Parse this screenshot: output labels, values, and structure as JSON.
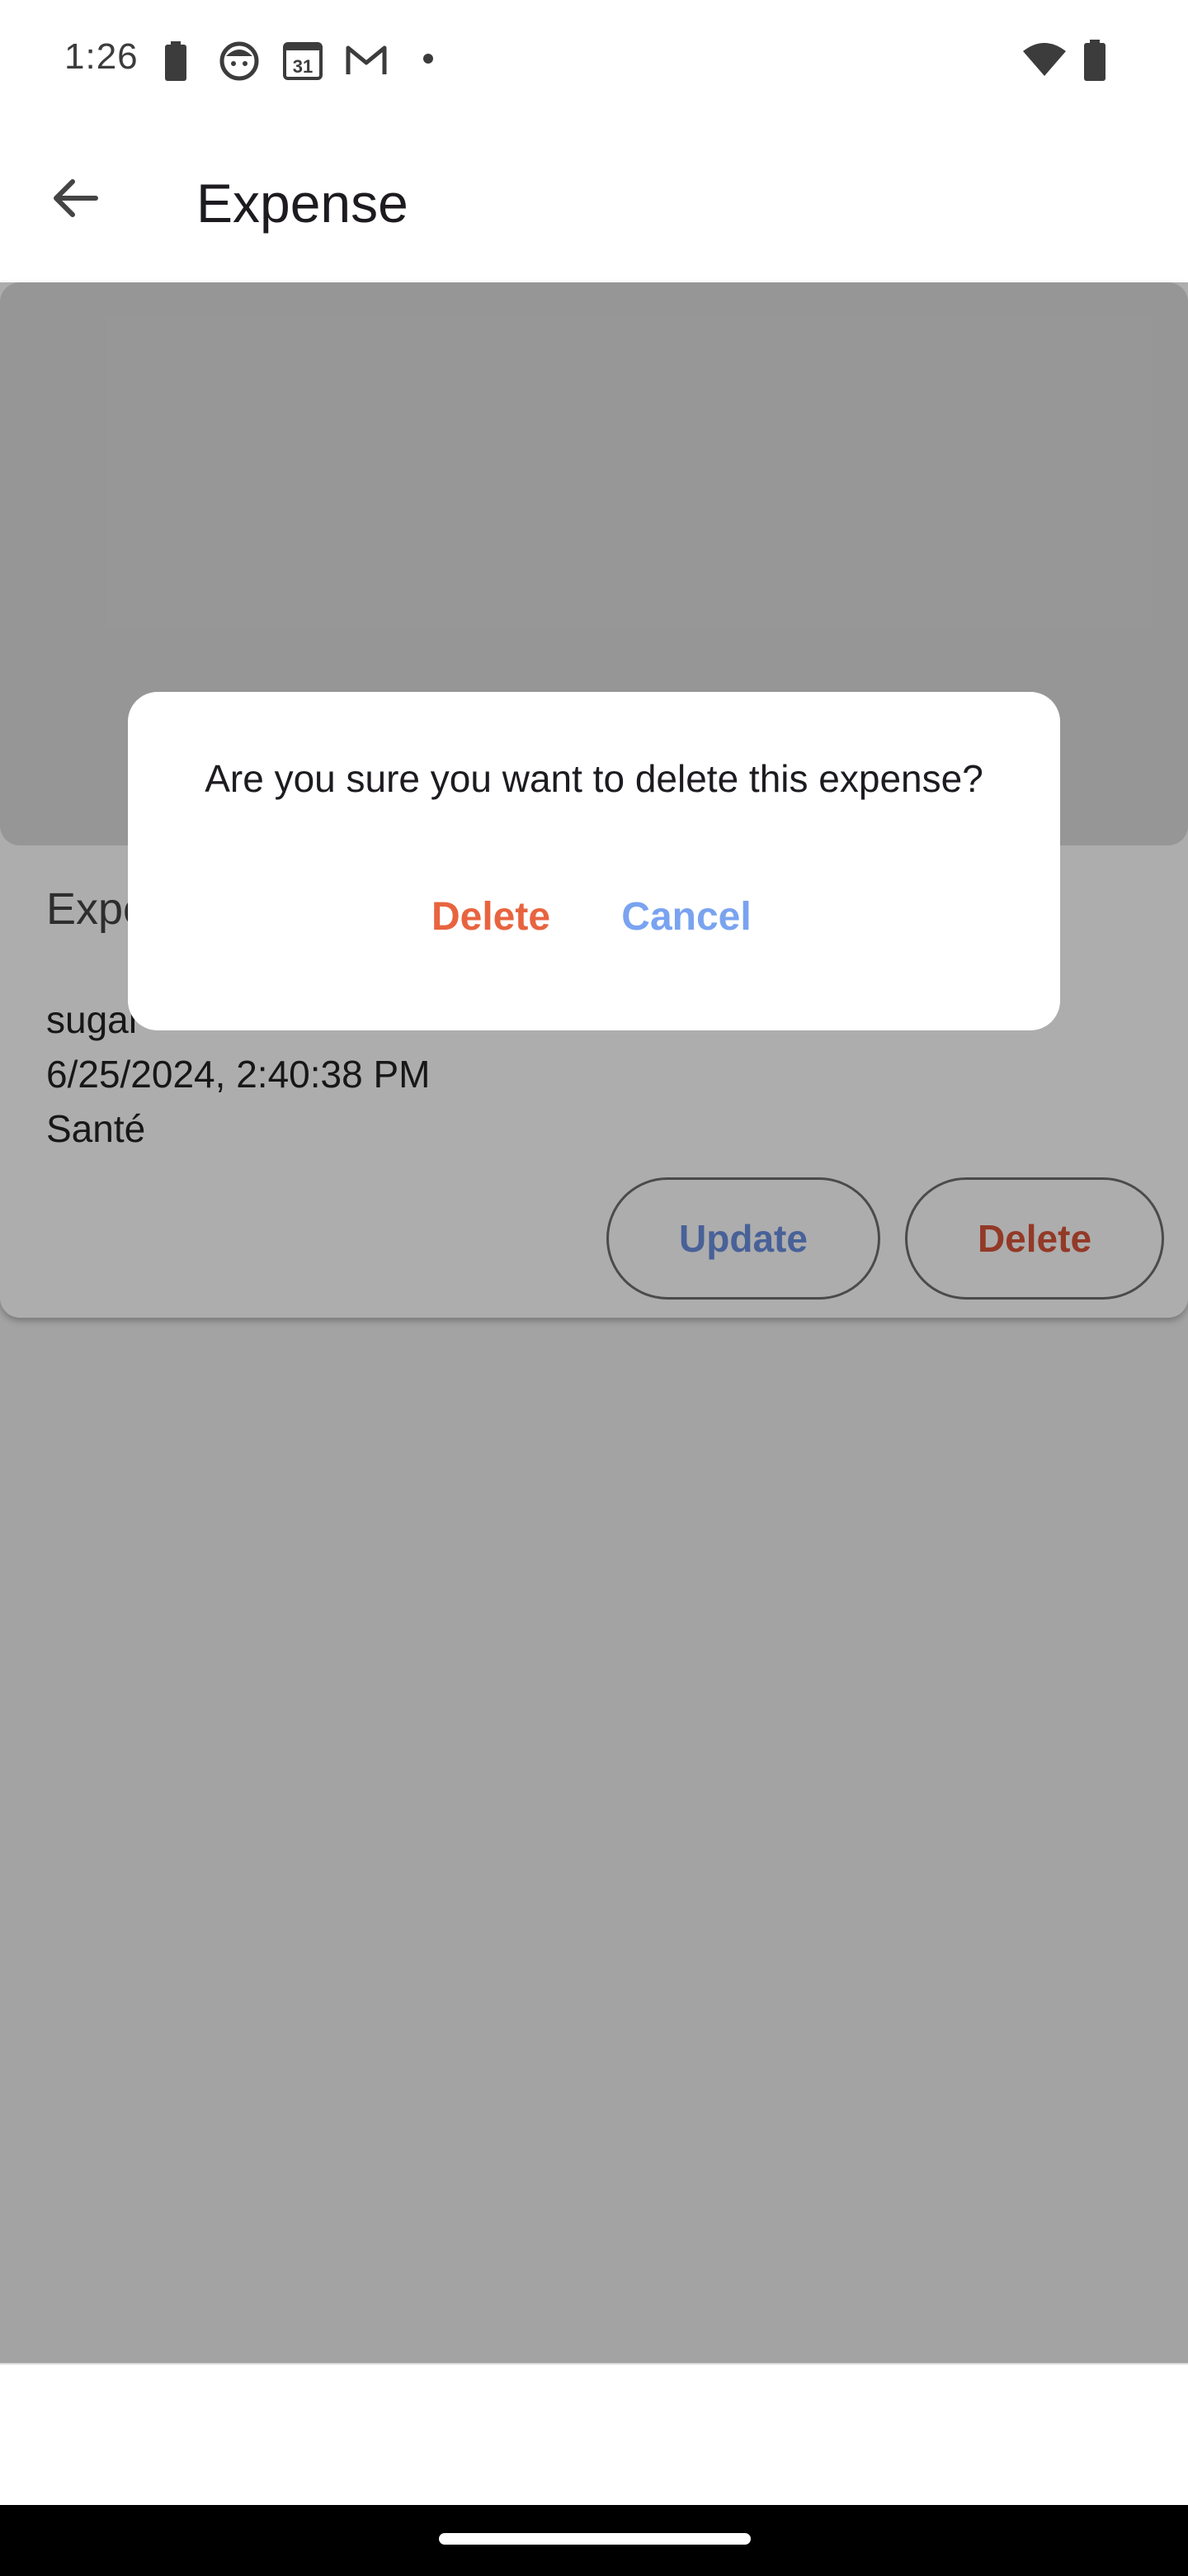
{
  "status_bar": {
    "time": "1:26",
    "icons": [
      "battery-saver-icon",
      "face-icon",
      "calendar-icon",
      "gmail-icon",
      "dot-icon",
      "wifi-icon",
      "battery-icon"
    ],
    "calendar_day": "31"
  },
  "app_bar": {
    "title": "Expense",
    "back_icon": "arrow-back-icon"
  },
  "expense": {
    "section_title": "Expe",
    "name": "sugar",
    "datetime": "6/25/2024, 2:40:38 PM",
    "category": "Santé",
    "update_label": "Update",
    "delete_label": "Delete"
  },
  "dialog": {
    "message": "Are you sure you want to delete this expense?",
    "confirm_label": "Delete",
    "cancel_label": "Cancel"
  },
  "colors": {
    "accent_blue": "#7aa3f0",
    "danger_red": "#e8643f"
  }
}
